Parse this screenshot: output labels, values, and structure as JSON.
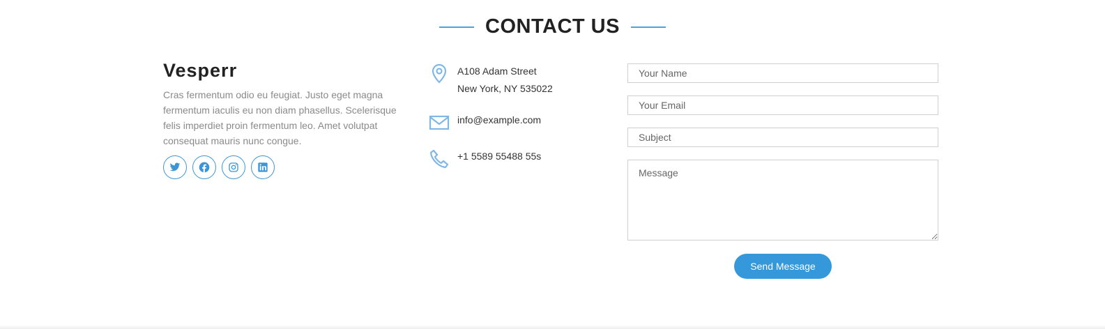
{
  "section": {
    "title": "CONTACT US"
  },
  "about": {
    "brand": "Vesperr",
    "description": "Cras fermentum odio eu feugiat. Justo eget magna fermentum iaculis eu non diam phasellus. Scelerisque felis imperdiet proin fermentum leo. Amet volutpat consequat mauris nunc congue.",
    "social": [
      "twitter-icon",
      "facebook-icon",
      "instagram-icon",
      "linkedin-icon"
    ]
  },
  "contact": {
    "address_line1": "A108 Adam Street",
    "address_line2": "New York, NY 535022",
    "email": "info@example.com",
    "phone": "+1 5589 55488 55s"
  },
  "form": {
    "name_placeholder": "Your Name",
    "email_placeholder": "Your Email",
    "subject_placeholder": "Subject",
    "message_placeholder": "Message",
    "submit_label": "Send Message"
  },
  "colors": {
    "accent": "#3498db",
    "icon": "#7fb8e6"
  }
}
